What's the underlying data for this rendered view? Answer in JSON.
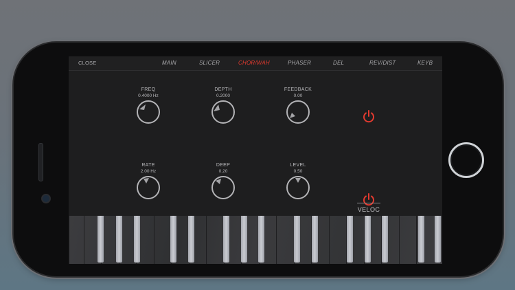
{
  "tabs": [
    {
      "label": "CLOSE"
    },
    {
      "label": "MAIN"
    },
    {
      "label": "SLICER"
    },
    {
      "label": "CHOR/WAH"
    },
    {
      "label": "PHASER"
    },
    {
      "label": "DEL"
    },
    {
      "label": "REV/DIST"
    },
    {
      "label": "KEYB"
    }
  ],
  "active_tab": "CHOR/WAH",
  "knobs": [
    {
      "label": "FREQ",
      "value": "0.4000 Hz"
    },
    {
      "label": "DEPTH",
      "value": "0.2000"
    },
    {
      "label": "FEEDBACK",
      "value": "0.00"
    },
    {
      "label": "RATE",
      "value": "2.00 Hz"
    },
    {
      "label": "DEEP",
      "value": "0.20"
    },
    {
      "label": "LEVEL",
      "value": "0.50"
    }
  ],
  "veloc_label": "VELOC",
  "colors": {
    "accent": "#e23a2f",
    "panel": "#1e1e1f",
    "text": "#b8b8bb"
  },
  "icons": {
    "power": "power-icon"
  }
}
